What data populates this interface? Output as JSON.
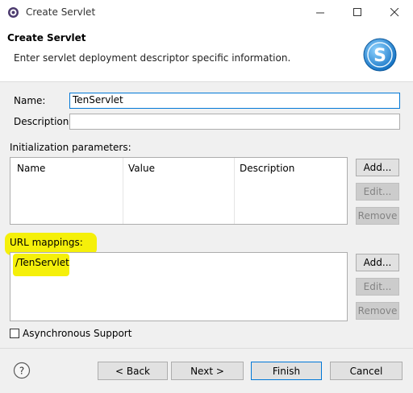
{
  "window": {
    "title": "Create Servlet"
  },
  "header": {
    "title": "Create Servlet",
    "description": "Enter servlet deployment descriptor specific information."
  },
  "form": {
    "name_label": "Name:",
    "name_value": "TenServlet",
    "description_label": "Description:",
    "description_value": ""
  },
  "init_params": {
    "section_label": "Initialization parameters:",
    "columns": [
      "Name",
      "Value",
      "Description"
    ],
    "add_label": "Add...",
    "edit_label": "Edit...",
    "remove_label": "Remove"
  },
  "url_mappings": {
    "section_label": "URL mappings:",
    "items": [
      "/TenServlet"
    ],
    "add_label": "Add...",
    "edit_label": "Edit...",
    "remove_label": "Remove"
  },
  "async": {
    "label": "Asynchronous Support",
    "checked": false
  },
  "footer": {
    "back_label": "< Back",
    "next_label": "Next >",
    "finish_label": "Finish",
    "cancel_label": "Cancel"
  },
  "icons": [
    "app-icon",
    "minimize-icon",
    "maximize-icon",
    "close-icon",
    "servlet-logo-icon",
    "help-icon"
  ],
  "colors": {
    "accent": "#0078d7",
    "highlight": "#f5f00a",
    "logo": "#1e8fd6"
  }
}
